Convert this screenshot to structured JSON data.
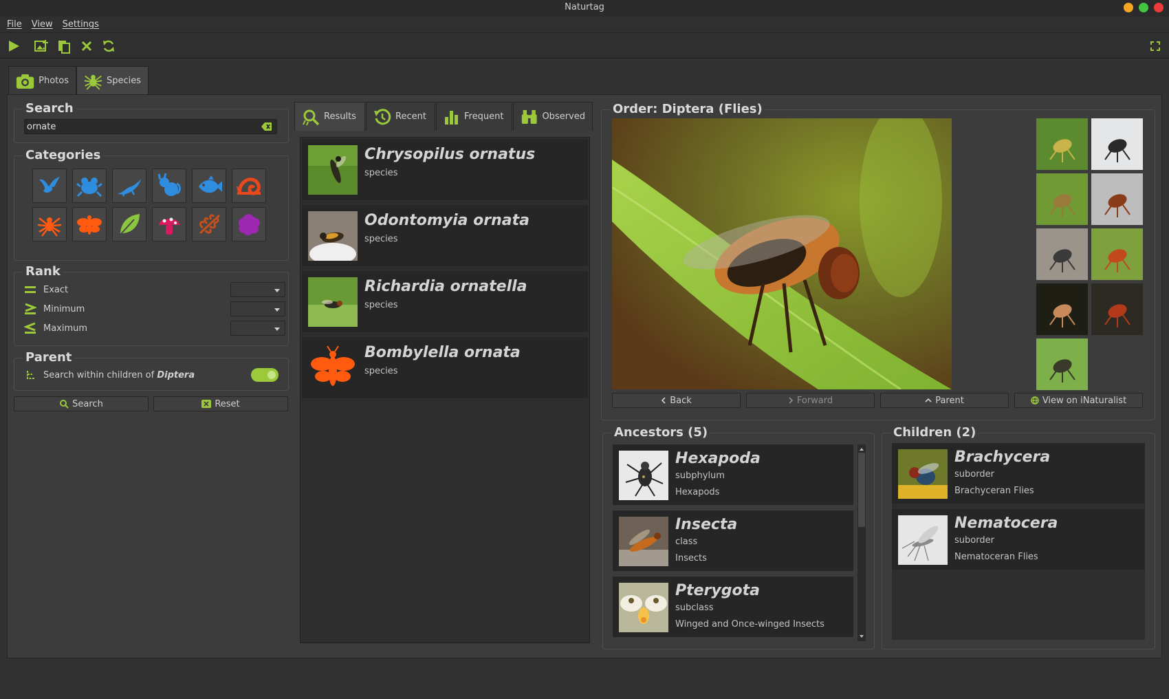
{
  "app": {
    "title": "Naturtag"
  },
  "menu": {
    "file": "File",
    "view": "View",
    "settings": "Settings"
  },
  "main_tabs": {
    "photos": "Photos",
    "species": "Species"
  },
  "search": {
    "title": "Search",
    "value": "ornate"
  },
  "categories": {
    "title": "Categories",
    "items": [
      {
        "icon": "bird-icon",
        "color": "#2f8de0"
      },
      {
        "icon": "frog-icon",
        "color": "#2f8de0"
      },
      {
        "icon": "lizard-icon",
        "color": "#2f8de0"
      },
      {
        "icon": "mammal-icon",
        "color": "#2f8de0"
      },
      {
        "icon": "fish-icon",
        "color": "#2f8de0"
      },
      {
        "icon": "mollusk-icon",
        "color": "#e8481b"
      },
      {
        "icon": "spider-icon",
        "color": "#ff5a10"
      },
      {
        "icon": "insect-icon",
        "color": "#ff5a10"
      },
      {
        "icon": "plant-icon",
        "color": "#8cc63f"
      },
      {
        "icon": "fungus-icon",
        "color": "#d81b60"
      },
      {
        "icon": "protozoa-icon",
        "color": "#c4501c"
      },
      {
        "icon": "chromista-icon",
        "color": "#9c27b0"
      }
    ]
  },
  "rank": {
    "title": "Rank",
    "exact": "Exact",
    "minimum": "Minimum",
    "maximum": "Maximum"
  },
  "parent": {
    "title": "Parent",
    "label_prefix": "Search within children of",
    "taxon": "Diptera",
    "enabled": true
  },
  "buttons": {
    "search": "Search",
    "reset": "Reset"
  },
  "result_tabs": {
    "results": "Results",
    "recent": "Recent",
    "frequent": "Frequent",
    "observed": "Observed"
  },
  "results": [
    {
      "name": "Chrysopilus ornatus",
      "rank": "species"
    },
    {
      "name": "Odontomyia ornata",
      "rank": "species"
    },
    {
      "name": "Richardia ornatella",
      "rank": "species"
    },
    {
      "name": "Bombylella ornata",
      "rank": "species"
    }
  ],
  "taxon": {
    "title": "Order: Diptera (Flies)",
    "back": "Back",
    "forward": "Forward",
    "parent": "Parent",
    "view_on_inat": "View on iNaturalist"
  },
  "ancestors": {
    "title": "Ancestors (5)",
    "items": [
      {
        "name": "Hexapoda",
        "rank": "subphylum",
        "common": "Hexapods"
      },
      {
        "name": "Insecta",
        "rank": "class",
        "common": "Insects"
      },
      {
        "name": "Pterygota",
        "rank": "subclass",
        "common": "Winged and Once-winged Insects"
      }
    ]
  },
  "children": {
    "title": "Children (2)",
    "items": [
      {
        "name": "Brachycera",
        "rank": "suborder",
        "common": "Brachyceran Flies"
      },
      {
        "name": "Nematocera",
        "rank": "suborder",
        "common": "Nematoceran Flies"
      }
    ]
  },
  "colors": {
    "accent": "#9bc93b",
    "background": "#3c3c3c",
    "card": "#262626"
  }
}
